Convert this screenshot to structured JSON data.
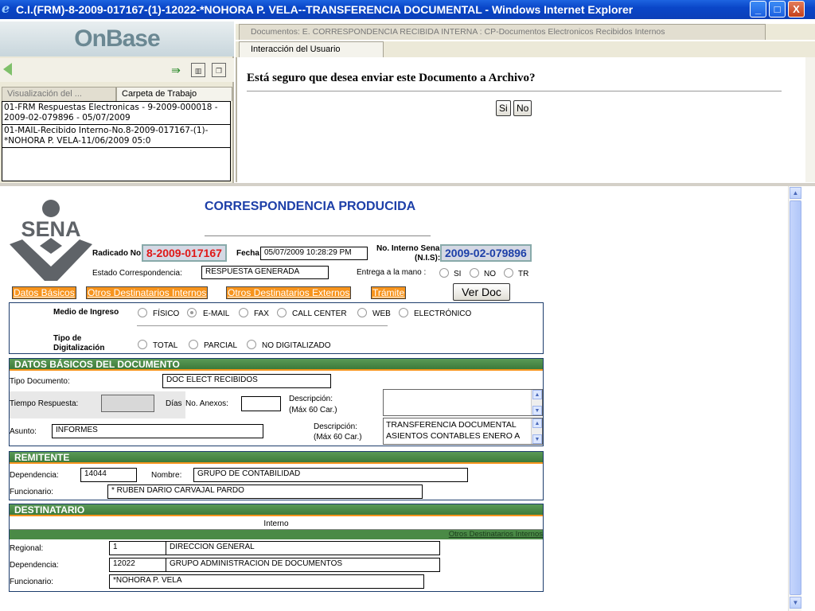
{
  "window": {
    "title": "C.I.(FRM)-8-2009-017167-(1)-12022-*NOHORA P. VELA--TRANSFERENCIA DOCUMENTAL - Windows Internet Explorer",
    "minimize": "_",
    "maximize": "□",
    "close": "X"
  },
  "left_panel": {
    "logo": "OnBase",
    "tabs": [
      "Visualización del ...",
      "Carpeta de Trabajo"
    ],
    "documents": [
      "01-FRM Respuestas Electronicas - 9-2009-000018 - 2009-02-079896 - 05/07/2009",
      "01-MAIL-Recibido Interno-No.8-2009-017167-(1)-*NOHORA P. VELA-11/06/2009 05:0"
    ]
  },
  "right_panel": {
    "doc_tab": "Documentos: E. CORRESPONDENCIA RECIBIDA INTERNA : CP-Documentos Electronicos Recibidos Internos",
    "interaction_tab": "Interacción del Usuario",
    "question": "Está seguro que desea enviar este Documento a Archivo?",
    "yes": "Si",
    "no": "No"
  },
  "form": {
    "logo_text": "SENA",
    "title": "CORRESPONDENCIA PRODUCIDA",
    "radicado_label": "Radicado No",
    "radicado": "8-2009-017167",
    "fecha_label": "Fecha",
    "fecha": "05/07/2009 10:28:29 PM",
    "interno_label": "No. Interno Sena",
    "nis_label": "(N.I.S):",
    "interno": "2009-02-079896",
    "estado_label": "Estado Correspondencia:",
    "estado": "RESPUESTA GENERADA",
    "entrega_label": "Entrega a la mano :",
    "entrega_options": [
      "SI",
      "NO",
      "TR"
    ],
    "tabs": [
      "Datos Básicos",
      "Otros Destinatarios Internos",
      "Otros Destinatarios Externos",
      "Trámite"
    ],
    "ver_doc": "Ver Doc",
    "medio_label": "Medio de Ingreso",
    "medio_options": [
      "FÍSICO",
      "E-MAIL",
      "FAX",
      "CALL CENTER",
      "WEB",
      "ELECTRÓNICO"
    ],
    "medio_selected": "E-MAIL",
    "tipo_dig_label_1": "Tipo de",
    "tipo_dig_label_2": "Digitalización",
    "tipo_dig_options": [
      "TOTAL",
      "PARCIAL",
      "NO DIGITALIZADO"
    ],
    "datos": {
      "header": "DATOS BÁSICOS DEL DOCUMENTO",
      "tipo_doc_label": "Tipo Documento:",
      "tipo_doc": "DOC ELECT RECIBIDOS",
      "tiempo_label": "Tiempo Respuesta:",
      "dias_label": "Días",
      "anexos_label": "No. Anexos:",
      "desc_label_1": "Descripción:",
      "desc_label_2": "(Máx 60 Car.)",
      "asunto_label": "Asunto:",
      "asunto": "INFORMES",
      "desc2_label_1": "Descripción:",
      "desc2_label_2": "(Máx 60 Car.)",
      "desc2_line1": "TRANSFERENCIA DOCUMENTAL",
      "desc2_line2": "ASIENTOS CONTABLES ENERO A"
    },
    "remitente": {
      "header": "REMITENTE",
      "dep_label": "Dependencia:",
      "dep": "14044",
      "nombre_label": "Nombre:",
      "nombre": "GRUPO DE CONTABILIDAD",
      "func_label": "Funcionario:",
      "func": "* RUBEN DARIO CARVAJAL PARDO"
    },
    "destinatario": {
      "header": "DESTINATARIO",
      "interno": "Interno",
      "otros": "Otros Destinatarios Internos",
      "regional_label": "Regional:",
      "regional_code": "1",
      "regional": "DIRECCION GENERAL",
      "dep_label": "Dependencia:",
      "dep_code": "12022",
      "dep": "GRUPO ADMINISTRACION DE DOCUMENTOS",
      "func_label": "Funcionario:",
      "func": "*NOHORA P. VELA"
    }
  },
  "colors": {
    "title_blue": "#1d3fa8",
    "radicado_red": "#e01818",
    "section_green": "#4a8a46",
    "tab_orange": "#f7941d"
  }
}
